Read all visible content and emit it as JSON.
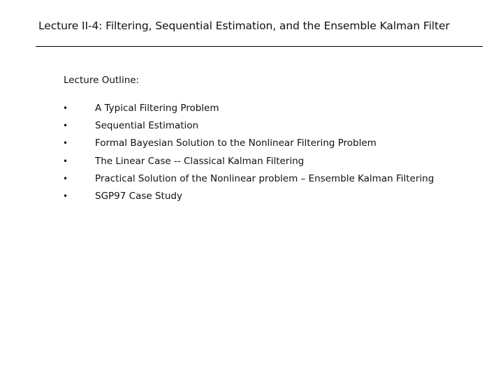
{
  "slide": {
    "title": "Lecture II-4: Filtering, Sequential Estimation, and the Ensemble Kalman Filter",
    "outline_heading": "Lecture Outline:",
    "bullet_glyph": "•",
    "items": [
      {
        "text": "A Typical Filtering Problem"
      },
      {
        "text": "Sequential Estimation"
      },
      {
        "text": "Formal Bayesian Solution to the Nonlinear Filtering Problem"
      },
      {
        "text": "The Linear Case -- Classical Kalman Filtering"
      },
      {
        "text": "Practical Solution of the Nonlinear problem – Ensemble Kalman Filtering"
      },
      {
        "text": "SGP97 Case Study"
      }
    ]
  }
}
